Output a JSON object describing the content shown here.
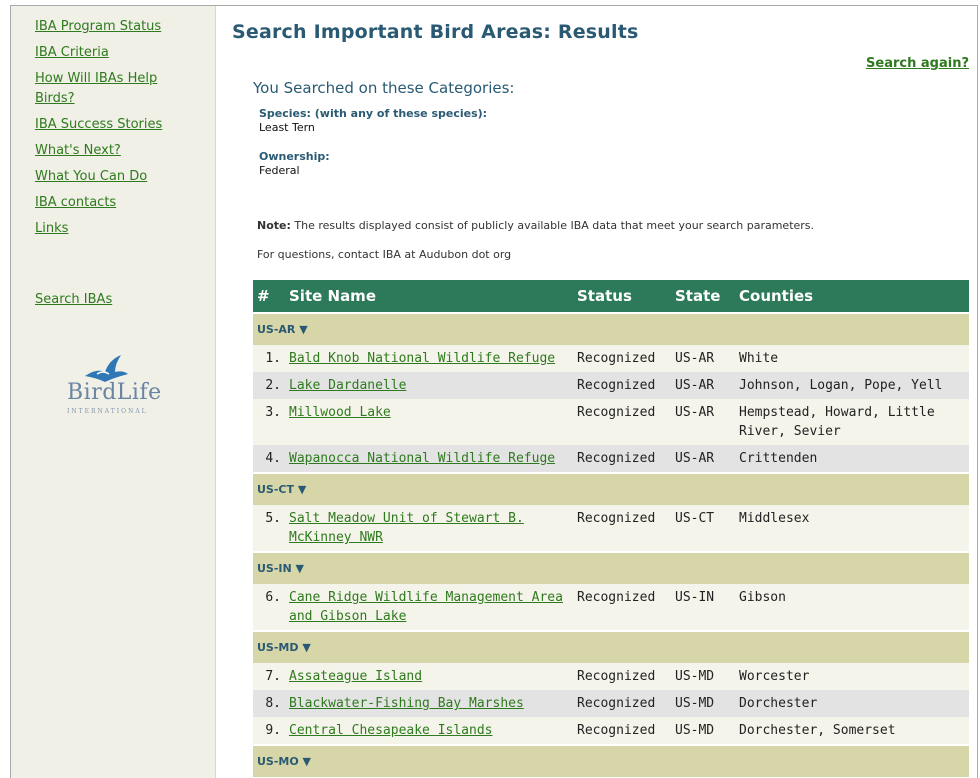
{
  "sidebar": {
    "nav": [
      "IBA Program Status",
      "IBA Criteria",
      "How Will IBAs Help Birds?",
      "IBA Success Stories",
      "What's Next?",
      "What You Can Do",
      "IBA contacts",
      "Links"
    ],
    "search_link": "Search IBAs",
    "logo_text": "BirdLife",
    "logo_subtext": "INTERNATIONAL"
  },
  "main": {
    "title": "Search Important Bird Areas:  Results",
    "search_again": "Search again?",
    "searched_heading": "You Searched on these Categories:",
    "criteria": [
      {
        "label": "Species: (with any of these species):",
        "value": "Least Tern"
      },
      {
        "label": "Ownership:",
        "value": "Federal"
      }
    ],
    "note_label": "Note:",
    "note_text": " The results displayed consist of publicly available IBA data that meet your search parameters.",
    "contact_text": "For questions, contact IBA at Audubon dot org"
  },
  "table": {
    "headers": [
      "#",
      "Site Name",
      "Status",
      "State",
      "Counties"
    ],
    "rows": [
      {
        "group": "US-AR ▼"
      },
      {
        "num": "1.",
        "site": "Bald Knob National Wildlife Refuge",
        "status": "Recognized",
        "state": "US-AR",
        "counties": "White"
      },
      {
        "num": "2.",
        "site": "Lake Dardanelle",
        "status": "Recognized",
        "state": "US-AR",
        "counties": "Johnson, Logan, Pope, Yell"
      },
      {
        "num": "3.",
        "site": "Millwood Lake",
        "status": "Recognized",
        "state": "US-AR",
        "counties": "Hempstead, Howard, Little River, Sevier"
      },
      {
        "num": "4.",
        "site": "Wapanocca National Wildlife Refuge",
        "status": "Recognized",
        "state": "US-AR",
        "counties": "Crittenden"
      },
      {
        "group": "US-CT ▼"
      },
      {
        "num": "5.",
        "site": "Salt Meadow Unit of Stewart B. McKinney NWR",
        "status": "Recognized",
        "state": "US-CT",
        "counties": "Middlesex"
      },
      {
        "group": "US-IN ▼"
      },
      {
        "num": "6.",
        "site": "Cane Ridge Wildlife Management Area and Gibson Lake",
        "status": "Recognized",
        "state": "US-IN",
        "counties": "Gibson"
      },
      {
        "group": "US-MD ▼"
      },
      {
        "num": "7.",
        "site": "Assateague Island",
        "status": "Recognized",
        "state": "US-MD",
        "counties": "Worcester"
      },
      {
        "num": "8.",
        "site": "Blackwater-Fishing Bay Marshes",
        "status": "Recognized",
        "state": "US-MD",
        "counties": "Dorchester"
      },
      {
        "num": "9.",
        "site": "Central Chesapeake Islands",
        "status": "Recognized",
        "state": "US-MD",
        "counties": "Dorchester, Somerset"
      },
      {
        "group": "US-MO ▼"
      }
    ]
  },
  "colors": {
    "header_green": "#2d7a5a",
    "link_green": "#2f7a1e",
    "title_blue": "#2a5a73",
    "group_band": "#d6d6a8"
  }
}
